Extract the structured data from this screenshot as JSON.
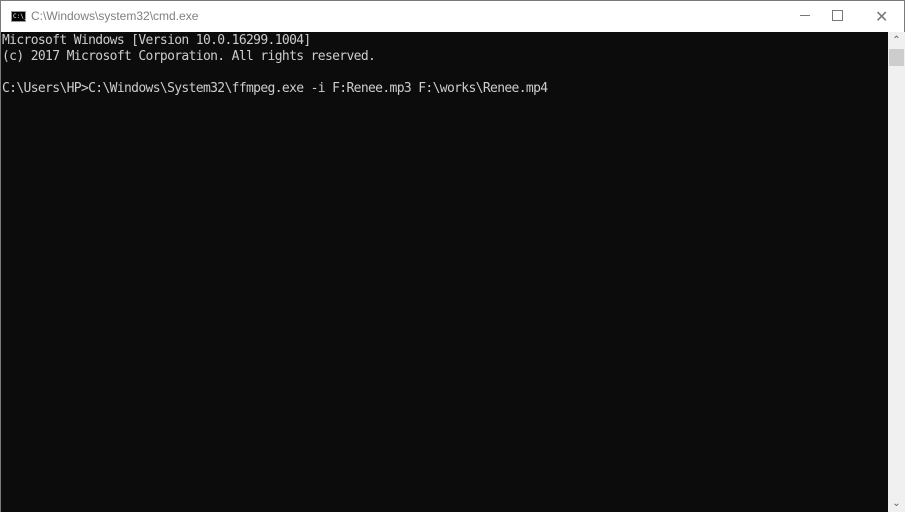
{
  "window": {
    "title": "C:\\Windows\\system32\\cmd.exe",
    "icon": "cmd-icon",
    "icon_text": "C:\\_",
    "controls": {
      "minimize": "minimize-icon",
      "maximize": "maximize-icon",
      "close": "close-icon"
    }
  },
  "console": {
    "lines": [
      "Microsoft Windows [Version 10.0.16299.1004]",
      "(c) 2017 Microsoft Corporation. All rights reserved.",
      "",
      "C:\\Users\\HP>C:\\Windows\\System32\\ffmpeg.exe -i F:Renee.mp3 F:\\works\\Renee.mp4"
    ],
    "text_color": "#cccccc",
    "background": "#0c0c0c"
  },
  "scrollbar": {
    "up_glyph": "⌃",
    "down_glyph": "⌄"
  }
}
